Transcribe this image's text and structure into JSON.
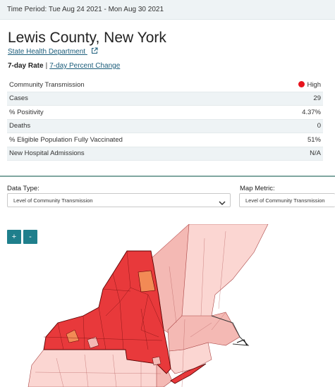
{
  "header": {
    "time_period": "Time Period: Tue Aug 24 2021 - Mon Aug 30 2021"
  },
  "county": {
    "name": "Lewis County, New York",
    "source_link": "State Health Department",
    "source_link_icon": "external-link-icon"
  },
  "rate_tabs": {
    "active": "7-day Rate",
    "separator": "|",
    "alternate": "7-day Percent Change"
  },
  "stats": [
    {
      "label": "Community Transmission",
      "value": "High",
      "indicator_color": "#e8131d"
    },
    {
      "label": "Cases",
      "value": "29"
    },
    {
      "label": "% Positivity",
      "value": "4.37%"
    },
    {
      "label": "Deaths",
      "value": "0"
    },
    {
      "label": "% Eligible Population Fully Vaccinated",
      "value": "51%"
    },
    {
      "label": "New Hospital Admissions",
      "value": "N/A"
    }
  ],
  "controls": {
    "data_type": {
      "label": "Data Type:",
      "selected": "Level of Community Transmission"
    },
    "map_metric": {
      "label": "Map Metric:",
      "selected": "Level of Community Transmission"
    },
    "zoom_in": "+",
    "zoom_out": "-"
  },
  "map_colors": {
    "high": "#e8393b",
    "substantial": "#f28a55",
    "moderate": "#f4b9b4",
    "low": "#fbd6d2",
    "accent": "#1f7f8c"
  }
}
